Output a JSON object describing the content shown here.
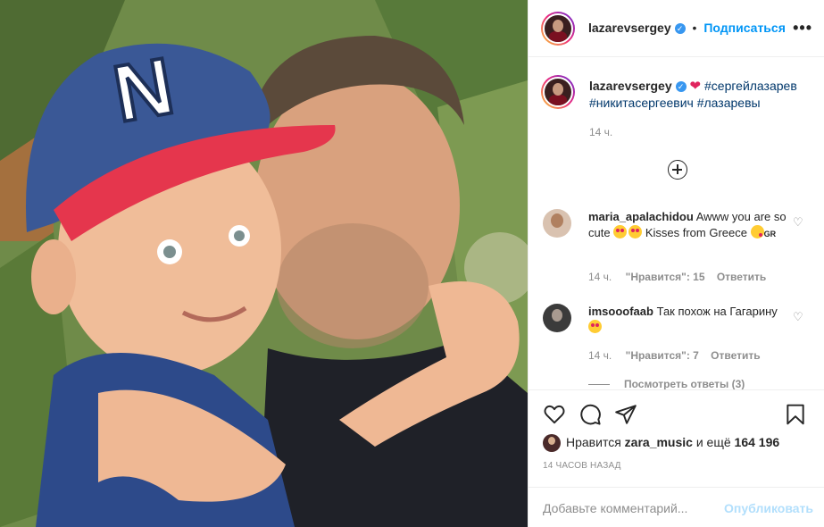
{
  "post": {
    "author": "lazarevsergey",
    "follow_label": "Подписаться",
    "bullet": "•",
    "more_label": "•••"
  },
  "caption": {
    "author": "lazarevsergey",
    "heart": "❤",
    "tag1": "#сергейлазарев",
    "tag2": "#никитасергеевич",
    "tag3": "#лазаревы",
    "time": "14 ч."
  },
  "comments": [
    {
      "user": "maria_apalachidou",
      "text_a": "Awww you are so cute",
      "text_b": "Kisses from Greece",
      "text_c": "GR",
      "time": "14 ч.",
      "likes": "\"Нравится\": 15",
      "reply": "Ответить"
    },
    {
      "user": "imsooofaab",
      "text_a": "Так похож на Гагарину",
      "time": "14 ч.",
      "likes": "\"Нравится\": 7",
      "reply": "Ответить",
      "view_replies": "Посмотреть ответы (3)"
    }
  ],
  "likes": {
    "prefix": "Нравится",
    "user": "zara_music",
    "middle": "и ещё",
    "count": "164 196"
  },
  "timestamp": "14 ЧАСОВ НАЗАД",
  "add_comment": {
    "placeholder": "Добавьте комментарий...",
    "publish_label": "Опубликовать"
  },
  "colors": {
    "accent": "#0095f6",
    "hashtag": "#00376b",
    "muted": "#8e8e8e",
    "publish_disabled": "#b2dffc"
  },
  "icons": [
    "more-icon",
    "verified-icon",
    "heart-icon",
    "comment-icon",
    "share-icon",
    "bookmark-icon",
    "load-more-icon"
  ]
}
